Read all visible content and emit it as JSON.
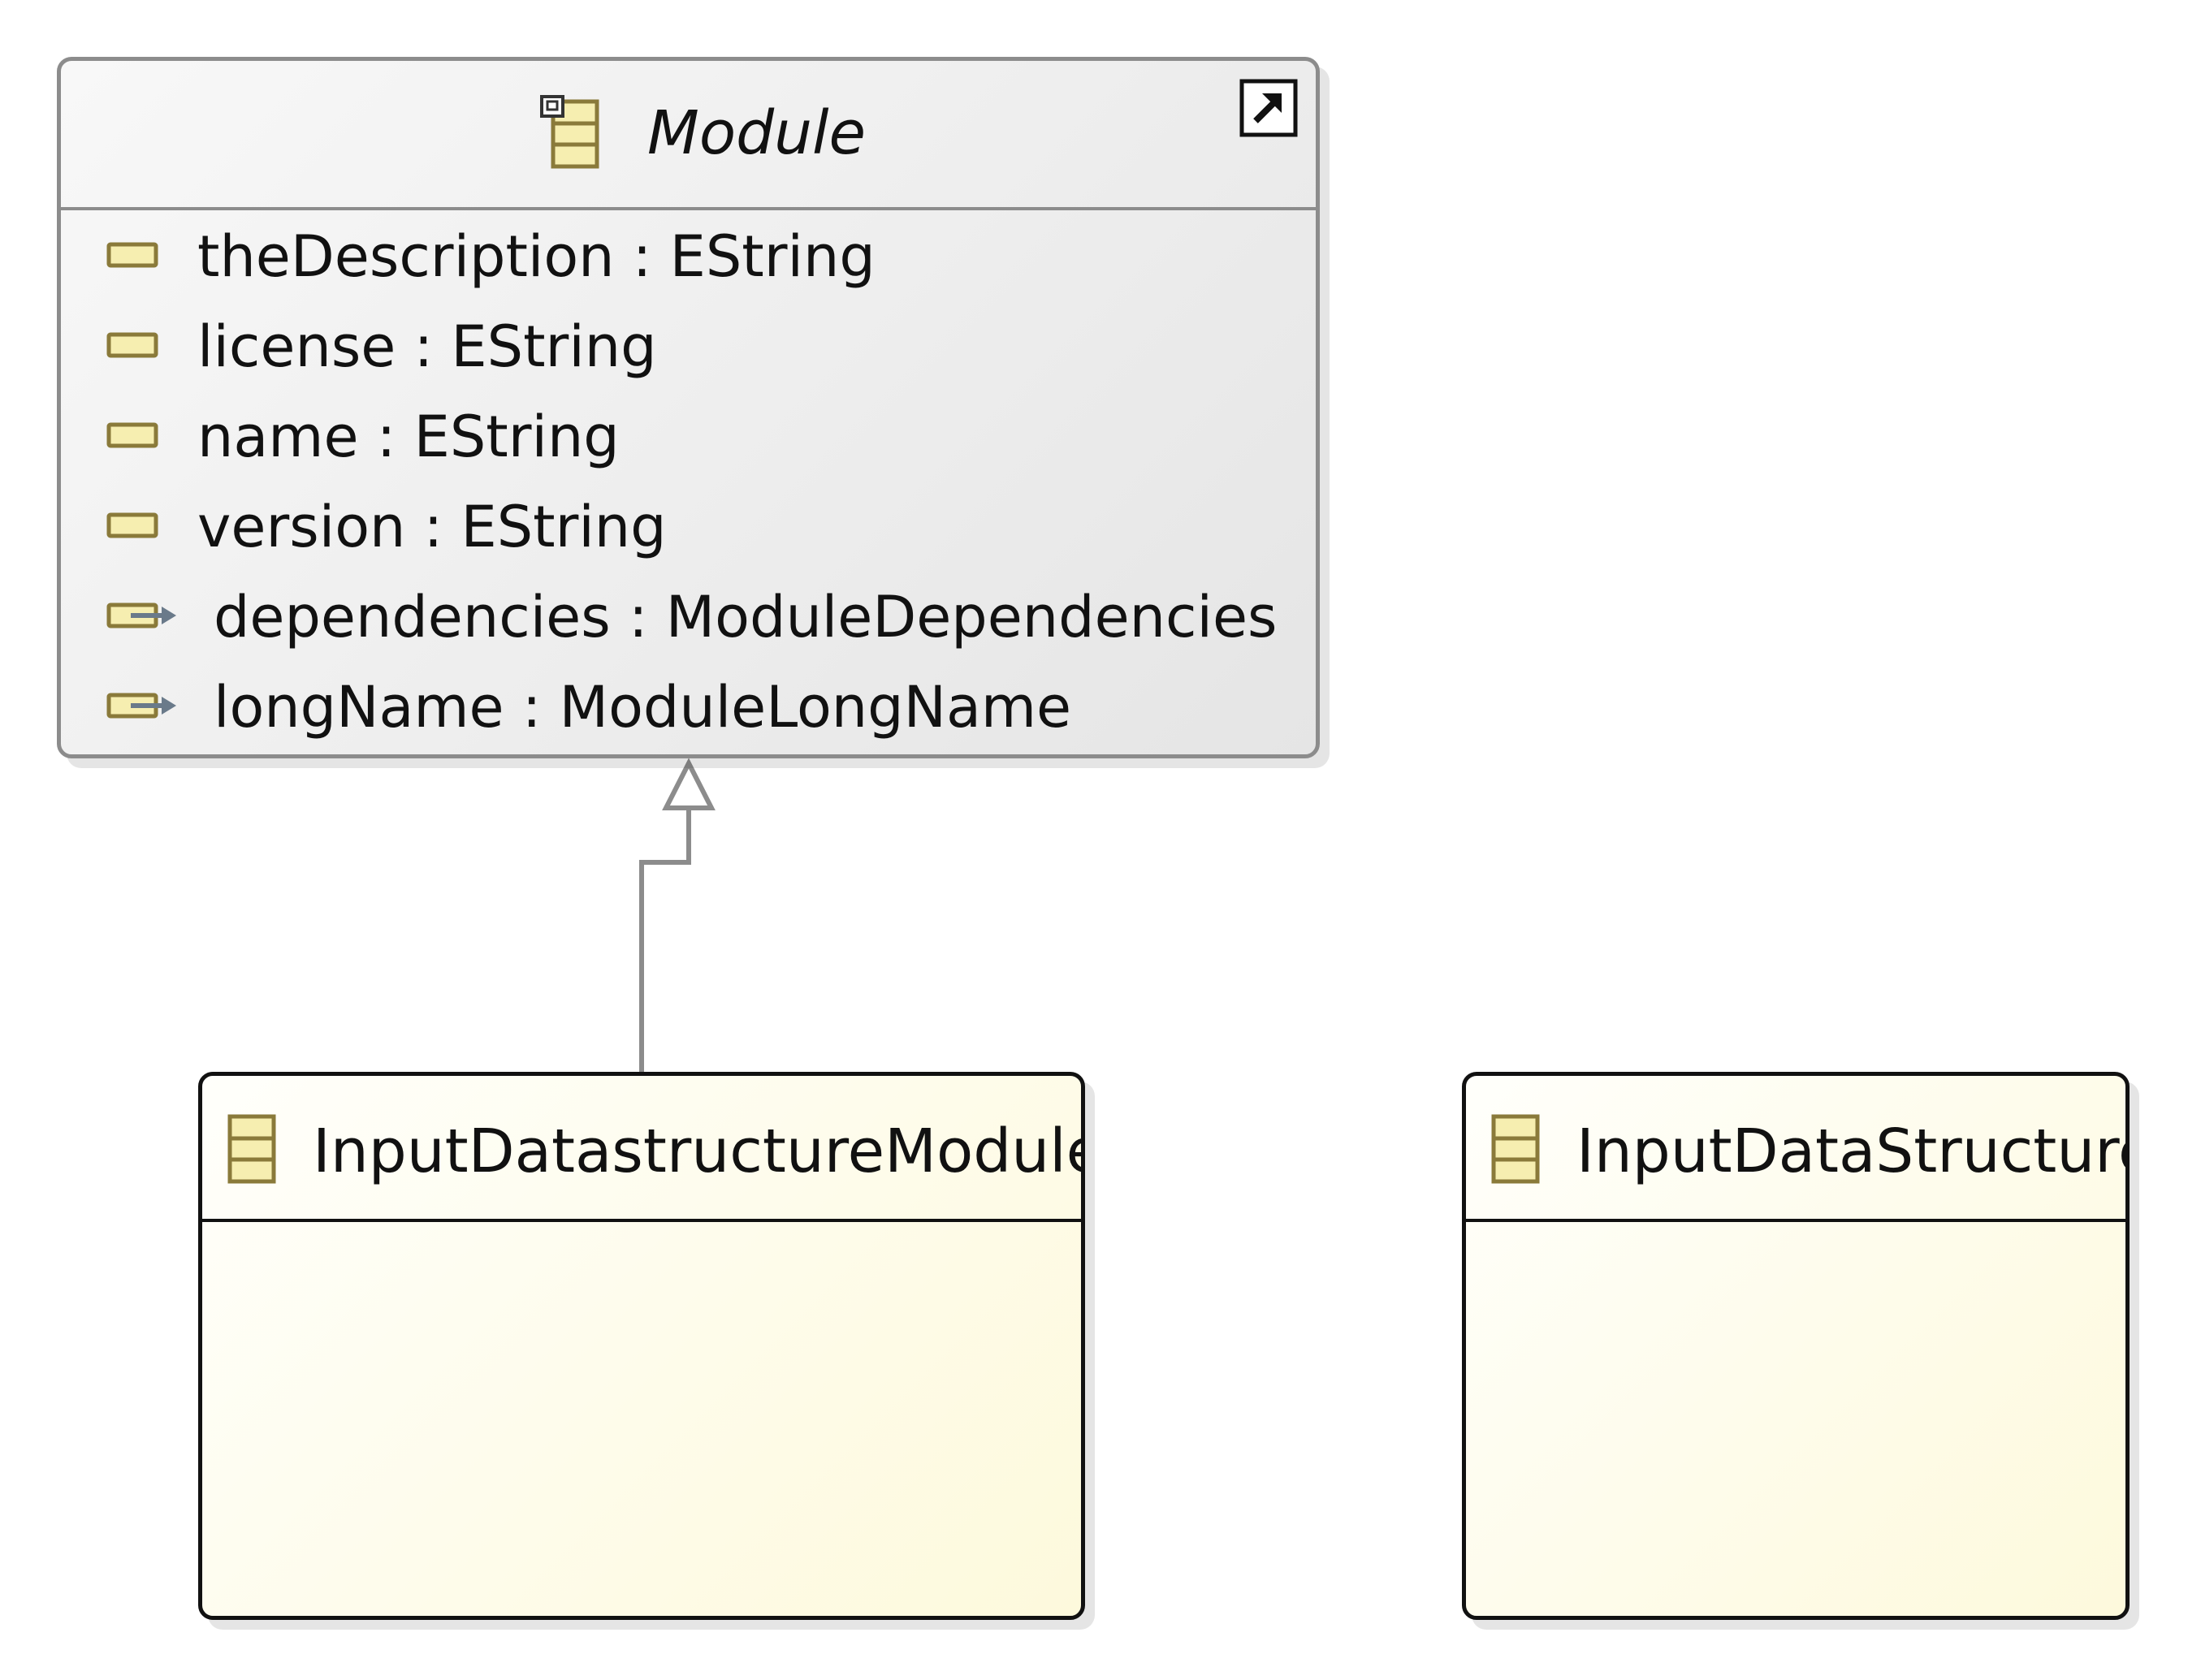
{
  "diagram": {
    "classes": [
      {
        "id": "module",
        "name": "Module",
        "abstract": true,
        "attributes": [
          {
            "label": "theDescription : EString",
            "kind": "attribute"
          },
          {
            "label": "license : EString",
            "kind": "attribute"
          },
          {
            "label": "name : EString",
            "kind": "attribute"
          },
          {
            "label": "version : EString",
            "kind": "attribute"
          },
          {
            "label": "dependencies : ModuleDependencies",
            "kind": "reference"
          },
          {
            "label": "longName : ModuleLongName",
            "kind": "reference"
          }
        ]
      },
      {
        "id": "input-datastructure-module",
        "name": "InputDatastructureModule",
        "abstract": false,
        "attributes": []
      },
      {
        "id": "input-data-structure",
        "name": "InputDataStructure",
        "abstract": false,
        "attributes": []
      }
    ],
    "relations": [
      {
        "type": "generalization",
        "from": "InputDatastructureModule",
        "to": "Module"
      }
    ]
  },
  "colors": {
    "abstract_border": "#8c8c8c",
    "class_border": "#111111",
    "class_fill": "#fdf9dc",
    "abstract_fill": "#eaeaea",
    "attribute_icon_fill": "#f6eeb0",
    "attribute_icon_border": "#8a7a3a",
    "reference_arrow": "#6a7a8a",
    "generalization_line": "#8c8c8c"
  },
  "icons": {
    "class_icon": "class-icon",
    "abstract_class_icon": "abstract-class-icon",
    "shortcut_icon": "shortcut-arrow-icon",
    "attribute_icon": "attribute-icon",
    "reference_icon": "reference-icon"
  }
}
